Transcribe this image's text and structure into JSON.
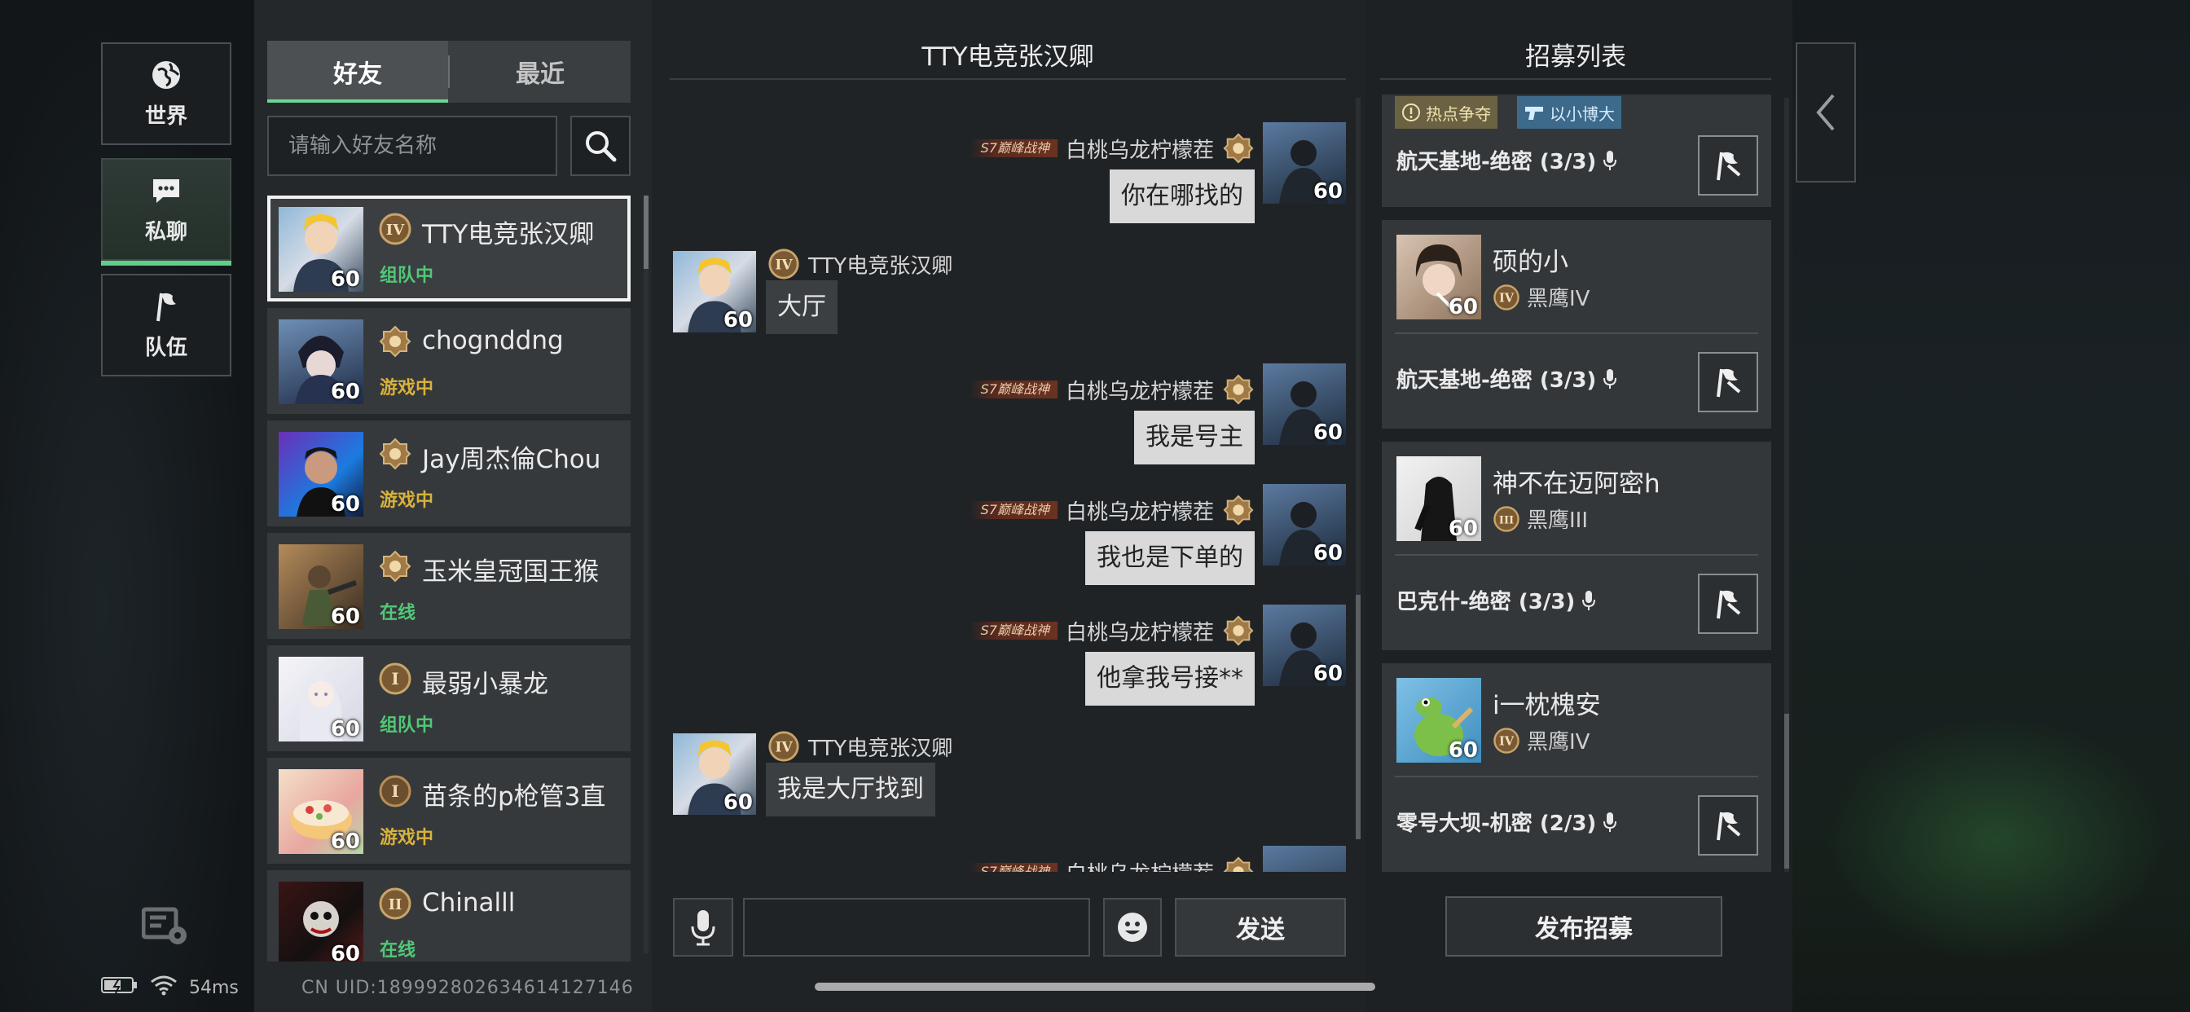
{
  "nav": {
    "items": [
      {
        "label": "世界",
        "icon": "globe-icon"
      },
      {
        "label": "私聊",
        "icon": "chat-bubble-icon",
        "active": true
      },
      {
        "label": "队伍",
        "icon": "flag-icon"
      }
    ]
  },
  "status_bar": {
    "ping": "54ms"
  },
  "friends": {
    "tabs": [
      {
        "label": "好友",
        "active": true
      },
      {
        "label": "最近"
      }
    ],
    "search_placeholder": "请输入好友名称",
    "list": [
      {
        "name": "TTY电竞张汉卿",
        "status": "组队中",
        "status_type": "team",
        "level": "60",
        "rank": "IV",
        "selected": true
      },
      {
        "name": "chognddng",
        "status": "游戏中",
        "status_type": "game",
        "level": "60",
        "rank": "crest"
      },
      {
        "name": "Jay周杰倫Chou",
        "status": "游戏中",
        "status_type": "game",
        "level": "60",
        "rank": "crest"
      },
      {
        "name": "玉米皇冠国王猴",
        "status": "在线",
        "status_type": "online",
        "level": "60",
        "rank": "crest"
      },
      {
        "name": "最弱小暴龙",
        "status": "组队中",
        "status_type": "team",
        "level": "60",
        "rank": "I"
      },
      {
        "name": "苗条的p枪管3直",
        "status": "游戏中",
        "status_type": "game",
        "level": "60",
        "rank": "I"
      },
      {
        "name": "Chinalll",
        "status": "在线",
        "status_type": "online",
        "level": "60",
        "rank": "II"
      }
    ],
    "uid_text": "CN UID:189992802634614127146"
  },
  "chat": {
    "title": "TTY电竞张汉卿",
    "title_badge": "S7巅峰战神",
    "messages": [
      {
        "side": "right",
        "sender": "白桃乌龙柠檬茬",
        "text": "你在哪找的",
        "level": "60"
      },
      {
        "side": "left",
        "sender": "TTY电竞张汉卿",
        "text": "大厅",
        "level": "60"
      },
      {
        "side": "right",
        "sender": "白桃乌龙柠檬茬",
        "text": "我是号主",
        "level": "60"
      },
      {
        "side": "right",
        "sender": "白桃乌龙柠檬茬",
        "text": "我也是下单的",
        "level": "60"
      },
      {
        "side": "right",
        "sender": "白桃乌龙柠檬茬",
        "text": "他拿我号接**",
        "level": "60"
      },
      {
        "side": "left",
        "sender": "TTY电竞张汉卿",
        "text": "我是大厅找到",
        "level": "60"
      },
      {
        "side": "right",
        "sender": "白桃乌龙柠檬茬",
        "text": "",
        "level": "60",
        "partial": true
      }
    ],
    "input_value": "",
    "send_label": "发送"
  },
  "recruit": {
    "title": "招募列表",
    "tags": [
      "热点争夺",
      "以小博大"
    ],
    "cards": [
      {
        "partial": true,
        "map": "航天基地-绝密 (3/3)"
      },
      {
        "name": "硕的小",
        "rank": "黑鹰IV",
        "rank_numeral": "IV",
        "level": "60",
        "map": "航天基地-绝密 (3/3)"
      },
      {
        "name": "神不在迈阿密h",
        "rank": "黑鹰III",
        "rank_numeral": "III",
        "level": "60",
        "map": "巴克什-绝密 (3/3)"
      },
      {
        "name": "i一枕槐安",
        "rank": "黑鹰IV",
        "rank_numeral": "IV",
        "level": "60",
        "map": "零号大坝-机密 (2/3)"
      }
    ],
    "publish_label": "发布招募"
  },
  "colors": {
    "accent": "#5fd08a",
    "status_team": "#52c877",
    "status_game": "#d9b23a"
  }
}
